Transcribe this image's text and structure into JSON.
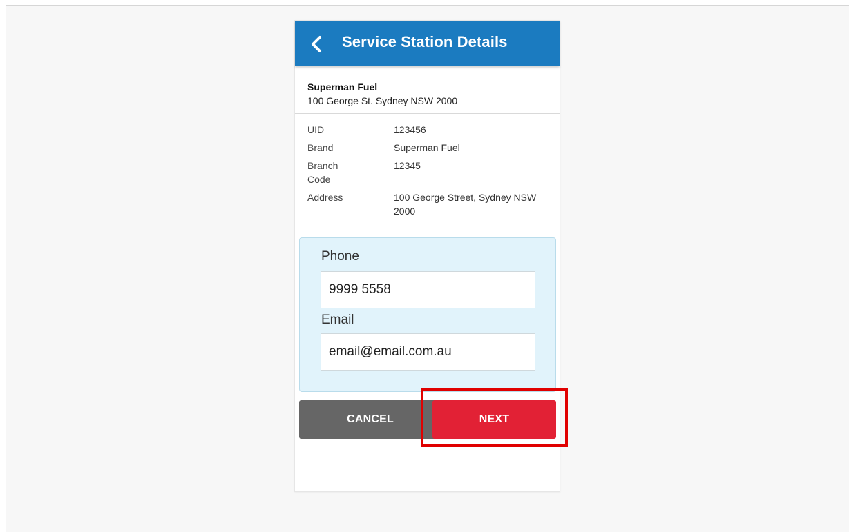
{
  "appbar": {
    "title": "Service Station Details",
    "back_icon": "chevron-left-icon",
    "background": "#1b7bc0"
  },
  "station": {
    "name": "Superman Fuel",
    "address": "100 George St. Sydney NSW 2000"
  },
  "details": [
    {
      "label": "UID",
      "value": "123456"
    },
    {
      "label": "Brand",
      "value": "Superman Fuel"
    },
    {
      "label": "Branch Code",
      "value": "12345"
    },
    {
      "label": "Address",
      "value": "100 George Street, Sydney NSW 2000"
    }
  ],
  "contact": {
    "phone_label": "Phone",
    "phone_value": "9999 5558",
    "email_label": "Email",
    "email_value": "email@email.com.au"
  },
  "actions": {
    "cancel_label": "CANCEL",
    "next_label": "NEXT",
    "cancel_color": "#666666",
    "next_color": "#e22135",
    "highlight_color": "#e00000"
  }
}
